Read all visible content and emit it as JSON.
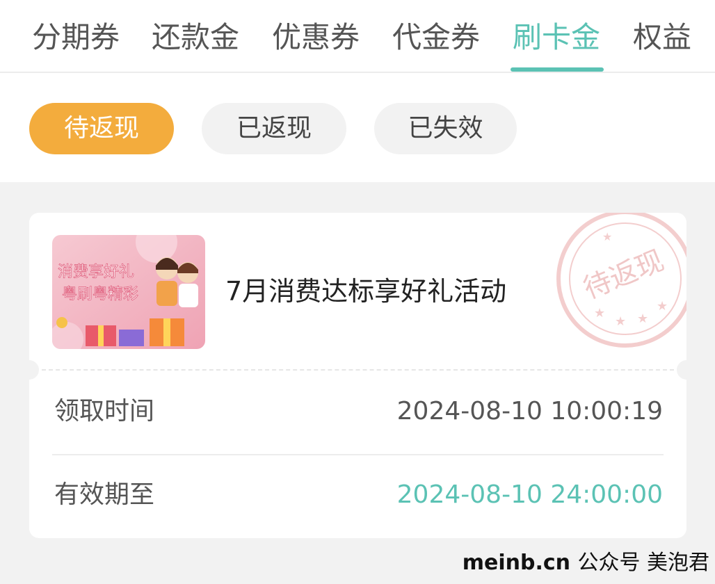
{
  "tabs": [
    {
      "label": "分期券"
    },
    {
      "label": "还款金"
    },
    {
      "label": "优惠券"
    },
    {
      "label": "代金券"
    },
    {
      "label": "刷卡金",
      "active": true
    },
    {
      "label": "权益"
    }
  ],
  "filters": [
    {
      "label": "待返现",
      "active": true
    },
    {
      "label": "已返现"
    },
    {
      "label": "已失效"
    }
  ],
  "card": {
    "image_text_1": "消费享好礼",
    "image_text_2": "粤刷粤精彩",
    "title": "7月消费达标享好礼活动",
    "stamp_text": "待返现",
    "claim_label": "领取时间",
    "claim_time": "2024-08-10 10:00:19",
    "valid_label": "有效期至",
    "valid_until": "2024-08-10 24:00:00"
  },
  "watermark": {
    "site": "meinb.cn",
    "text": "公众号 美泡君"
  },
  "colors": {
    "accent": "#5bc2b4",
    "active_pill": "#f3ac3d",
    "background": "#f2f2f2"
  }
}
